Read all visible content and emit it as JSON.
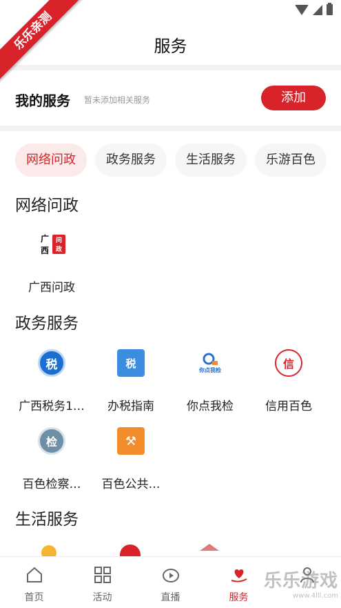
{
  "ribbon": {
    "text": "乐乐亲测"
  },
  "header": {
    "title": "服务"
  },
  "my_services": {
    "title": "我的服务",
    "hint": "暂未添加相关服务",
    "add_label": "添加"
  },
  "tabs": [
    {
      "label": "网络问政",
      "active": true
    },
    {
      "label": "政务服务",
      "active": false
    },
    {
      "label": "生活服务",
      "active": false
    },
    {
      "label": "乐游百色",
      "active": false
    }
  ],
  "sections": {
    "wangluo": {
      "title": "网络问政",
      "items": [
        {
          "label": "广西问政",
          "icon": "guangxi-wenzheng-logo",
          "logo_text": "广西",
          "logo_badge": "问政"
        }
      ]
    },
    "zhengwu": {
      "title": "政务服务",
      "items": [
        {
          "label": "广西税务1…",
          "icon": "tax-circle-icon",
          "glyph": "税"
        },
        {
          "label": "办税指南",
          "icon": "tax-guide-icon",
          "glyph": "税"
        },
        {
          "label": "你点我检",
          "icon": "inspect-icon",
          "caption": "你点我检"
        },
        {
          "label": "信用百色",
          "icon": "credit-baise-icon",
          "glyph": "信"
        },
        {
          "label": "百色检察…",
          "icon": "procuratorate-icon",
          "glyph": "检"
        },
        {
          "label": "百色公共…",
          "icon": "public-resource-icon",
          "glyph": "⚒"
        }
      ]
    },
    "shenghuo": {
      "title": "生活服务"
    }
  },
  "bottom_nav": [
    {
      "label": "首页",
      "icon": "home-icon",
      "active": false
    },
    {
      "label": "活动",
      "icon": "grid-icon",
      "active": false
    },
    {
      "label": "直播",
      "icon": "live-icon",
      "active": false
    },
    {
      "label": "服务",
      "icon": "heart-hand-icon",
      "active": true
    },
    {
      "label": "",
      "icon": "profile-icon",
      "active": false
    }
  ],
  "watermark": {
    "brand": "乐乐游戏",
    "url": "www.4lll.com"
  },
  "colors": {
    "accent": "#d8232a",
    "tax_blue": "#1a6fd0",
    "orange": "#f28c2b"
  }
}
